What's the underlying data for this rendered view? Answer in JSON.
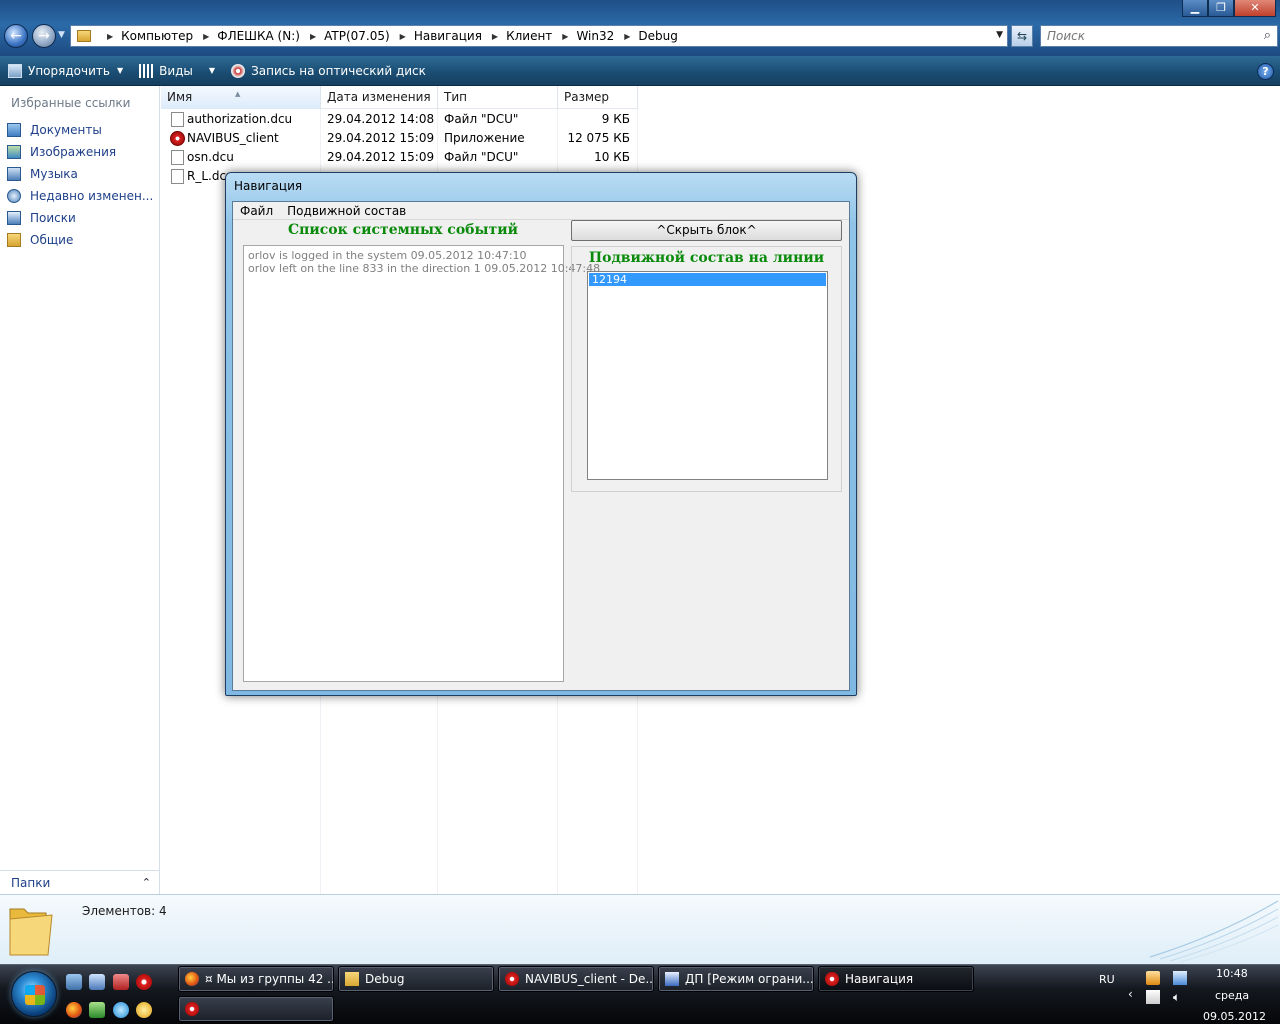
{
  "explorer": {
    "breadcrumbs": [
      "Компьютер",
      "ФЛЕШКА (N:)",
      "ATP(07.05)",
      "Навигация",
      "Клиент",
      "Win32",
      "Debug"
    ],
    "search_placeholder": "Поиск",
    "toolbar": {
      "organize": "Упорядочить",
      "views": "Виды",
      "burn": "Запись на оптический диск"
    },
    "nav_pane": {
      "header": "Избранные ссылки",
      "items": [
        "Документы",
        "Изображения",
        "Музыка",
        "Недавно изменен...",
        "Поиски",
        "Общие"
      ],
      "folders_label": "Папки"
    },
    "columns": [
      "Имя",
      "Дата изменения",
      "Тип",
      "Размер"
    ],
    "files": [
      {
        "name": "authorization.dcu",
        "date": "29.04.2012 14:08",
        "type": "Файл \"DCU\"",
        "size": "9 КБ",
        "icon": "file-icon"
      },
      {
        "name": "NAVIBUS_client",
        "date": "29.04.2012 15:09",
        "type": "Приложение",
        "size": "12 075 КБ",
        "icon": "app-icon"
      },
      {
        "name": "osn.dcu",
        "date": "29.04.2012 15:09",
        "type": "Файл \"DCU\"",
        "size": "10 КБ",
        "icon": "file-icon"
      },
      {
        "name": "R_L.dcu",
        "date": "",
        "type": "",
        "size": "",
        "icon": "file-icon"
      }
    ],
    "details": {
      "items_count": "Элементов: 4"
    }
  },
  "dialog": {
    "title": "Навигация",
    "menu": [
      "Файл",
      "Подвижной состав"
    ],
    "events_title": "Список системных событий",
    "events": [
      "orlov is logged in the system 09.05.2012 10:47:10",
      "orlov left on the line 833 in the direction 1 09.05.2012 10:47:48"
    ],
    "hide_button": "^Скрыть блок^",
    "rolling_title": "Подвижной состав на линии",
    "rolling_items": [
      "12194"
    ],
    "rolling_selected": "12194"
  },
  "taskbar": {
    "tasks": [
      {
        "label": "¤ Мы из группы 42 ...",
        "active": false
      },
      {
        "label": "Debug",
        "active": false
      },
      {
        "label": "NAVIBUS_client - De...",
        "active": false
      },
      {
        "label": "ДП [Режим ограни...",
        "active": false
      },
      {
        "label": "Навигация",
        "active": true
      }
    ],
    "language": "RU",
    "clock": {
      "time": "10:48",
      "day": "среда",
      "date": "09.05.2012"
    }
  },
  "colors": {
    "accent_green": "#0a8a0a",
    "selection_blue": "#3399ff",
    "link_blue": "#1e3f8a"
  }
}
